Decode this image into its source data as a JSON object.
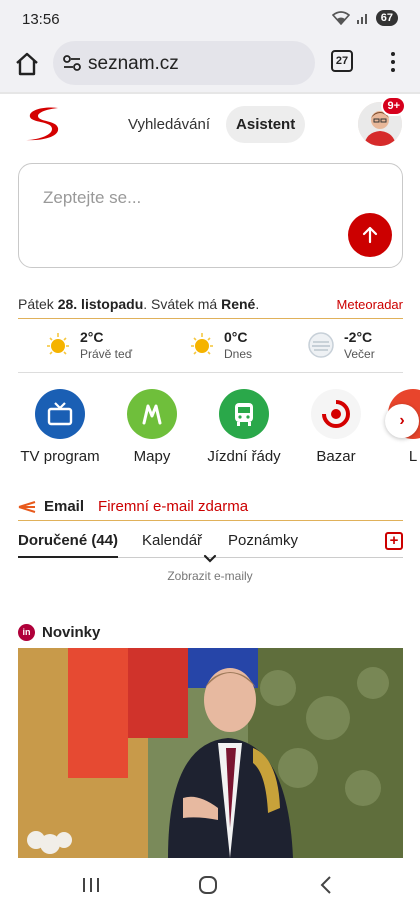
{
  "status_bar": {
    "time": "13:56",
    "battery": "67"
  },
  "browser": {
    "url": "seznam.cz",
    "tab_count": "27"
  },
  "header": {
    "tabs": [
      {
        "label": "Vyhledávání"
      },
      {
        "label": "Asistent"
      }
    ],
    "notification_count": "9+"
  },
  "ask": {
    "placeholder": "Zeptejte se..."
  },
  "date": {
    "day_prefix": "Pátek",
    "date": "28. listopadu",
    "holiday_prefix": ". Svátek má",
    "name": "René",
    "suffix": ".",
    "meteo_link": "Meteoradar"
  },
  "weather": [
    {
      "temp": "2°C",
      "label": "Právě teď",
      "icon": "sun-icon"
    },
    {
      "temp": "0°C",
      "label": "Dnes",
      "icon": "sun-icon"
    },
    {
      "temp": "-2°C",
      "label": "Večer",
      "icon": "moon-haze-icon"
    }
  ],
  "services": [
    {
      "label": "TV program",
      "icon": "tv-icon",
      "color": "#1a5fb4"
    },
    {
      "label": "Mapy",
      "icon": "map-icon",
      "color": "#6fbf3b"
    },
    {
      "label": "Jízdní řády",
      "icon": "bus-icon",
      "color": "#2aa84a"
    },
    {
      "label": "Bazar",
      "icon": "bazar-icon",
      "color": "#d40000"
    },
    {
      "label": "L",
      "icon": "partial-icon",
      "color": "#e8452c"
    }
  ],
  "email": {
    "title": "Email",
    "promo": "Firemní e-mail zdarma",
    "tabs": [
      {
        "label": "Doručené (44)"
      },
      {
        "label": "Kalendář"
      },
      {
        "label": "Poznámky"
      }
    ],
    "show_more": "Zobrazit e-maily"
  },
  "news": {
    "badge": "in",
    "title": "Novinky"
  },
  "colors": {
    "accent": "#cc0000",
    "rule": "#e0b15a"
  }
}
